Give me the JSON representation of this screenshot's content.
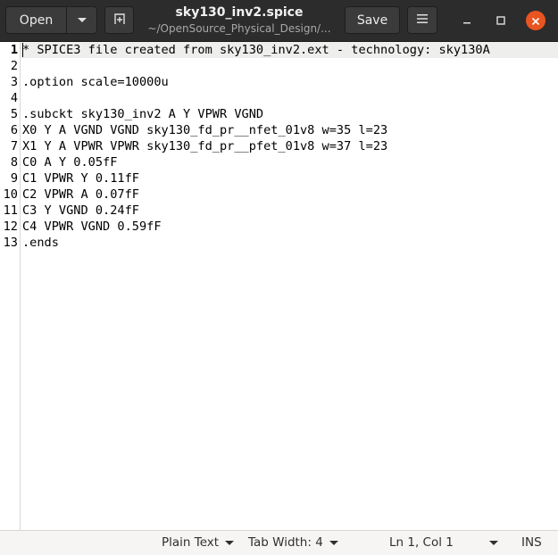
{
  "header": {
    "open_label": "Open",
    "save_label": "Save",
    "title": "sky130_inv2.spice",
    "subtitle": "~/OpenSource_Physical_Design/...",
    "icons": [
      "chevron-down-icon",
      "new-tab-icon",
      "hamburger-menu-icon",
      "minimize-icon",
      "maximize-icon",
      "close-icon"
    ]
  },
  "editor": {
    "line_numbers": [
      "1",
      "2",
      "3",
      "4",
      "5",
      "6",
      "7",
      "8",
      "9",
      "10",
      "11",
      "12",
      "13"
    ],
    "lines": [
      "* SPICE3 file created from sky130_inv2.ext - technology: sky130A",
      "",
      ".option scale=10000u",
      "",
      ".subckt sky130_inv2 A Y VPWR VGND",
      "X0 Y A VGND VGND sky130_fd_pr__nfet_01v8 w=35 l=23",
      "X1 Y A VPWR VPWR sky130_fd_pr__pfet_01v8 w=37 l=23",
      "C0 A Y 0.05fF",
      "C1 VPWR Y 0.11fF",
      "C2 VPWR A 0.07fF",
      "C3 Y VGND 0.24fF",
      "C4 VPWR VGND 0.59fF",
      ".ends"
    ]
  },
  "statusbar": {
    "language": "Plain Text",
    "tab_width": "Tab Width: 4",
    "position": "Ln 1, Col 1",
    "insert_mode": "INS"
  },
  "colors": {
    "headerbar": "#2c2c2c",
    "close_button": "#e95420",
    "current_line": "#eeeeec",
    "statusbar": "#f6f5f4"
  }
}
